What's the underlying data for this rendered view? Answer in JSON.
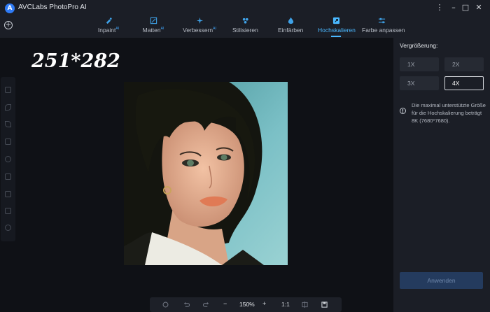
{
  "window": {
    "title": "AVCLabs PhotoPro AI",
    "logo_letter": "A",
    "minimize_label": "–",
    "maximize_label": "□",
    "close_label": "✕",
    "more_label": "⋮"
  },
  "tabs": [
    {
      "label": "Inpaint",
      "badge": "AI",
      "icon": "inpaint-icon"
    },
    {
      "label": "Matten",
      "badge": "AI",
      "icon": "matte-icon"
    },
    {
      "label": "Verbessern",
      "badge": "AI",
      "icon": "enhance-icon"
    },
    {
      "label": "Stilisieren",
      "badge": "",
      "icon": "stylize-icon"
    },
    {
      "label": "Einfärben",
      "badge": "",
      "icon": "colorize-icon"
    },
    {
      "label": "Hochskalieren",
      "badge": "",
      "icon": "upscale-icon",
      "active": true
    },
    {
      "label": "Farbe anpassen",
      "badge": "",
      "icon": "adjust-color-icon"
    }
  ],
  "add_button_label": "+",
  "canvas": {
    "size_label": "251*282"
  },
  "bottom_bar": {
    "zoom_out_label": "−",
    "zoom_value": "150%",
    "zoom_in_label": "+",
    "actual_size_label": "1:1"
  },
  "right_panel": {
    "title": "Vergrößerung:",
    "options": [
      "1X",
      "2X",
      "3X",
      "4X"
    ],
    "selected": "4X",
    "info_icon_label": "!",
    "info_text": "Die maximal unterstützte Größe für die Hochskalierung beträgt 8K (7680*7680).",
    "apply_label": "Anwenden"
  },
  "colors": {
    "accent": "#4ab8ff",
    "background": "#0f1116",
    "panel": "#1b1e26",
    "apply_button": "#243b5e"
  }
}
